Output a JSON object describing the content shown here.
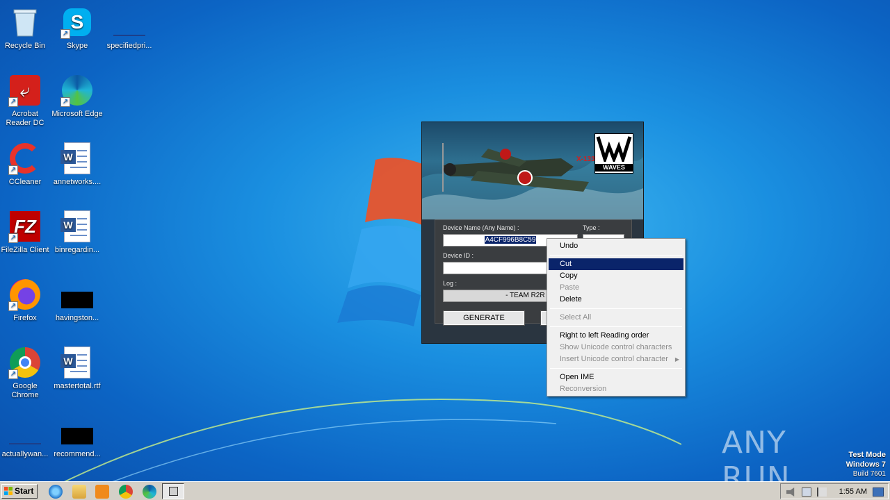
{
  "desktop": {
    "icons": [
      {
        "label": "Recycle Bin"
      },
      {
        "label": "Skype"
      },
      {
        "label": "specifiedpri..."
      },
      {
        "label": "Acrobat Reader DC"
      },
      {
        "label": "Microsoft Edge"
      },
      {
        "label": "CCleaner"
      },
      {
        "label": "annetworks...."
      },
      {
        "label": "FileZilla Client"
      },
      {
        "label": "binregardin..."
      },
      {
        "label": "Firefox"
      },
      {
        "label": "havingston..."
      },
      {
        "label": "Google Chrome"
      },
      {
        "label": "mastertotal.rtf"
      },
      {
        "label": "actuallywan..."
      },
      {
        "label": "recommend..."
      }
    ]
  },
  "keygen": {
    "brand": "WAVES",
    "plane_marking": "X-133",
    "device_name_label": "Device Name (Any Name) :",
    "type_label": "Type :",
    "device_name_value": "A4CF996B8C59",
    "device_id_label": "Device ID :",
    "log_label": "Log :",
    "log_value": "- TEAM R2R PRE",
    "generate_button": "GENERATE"
  },
  "context_menu": {
    "items": [
      {
        "label": "Undo",
        "enabled": true
      },
      {
        "label": "Cut",
        "enabled": true,
        "highlighted": true
      },
      {
        "label": "Copy",
        "enabled": true
      },
      {
        "label": "Paste",
        "enabled": false
      },
      {
        "label": "Delete",
        "enabled": true
      },
      {
        "label": "Select All",
        "enabled": false
      },
      {
        "label": "Right to left Reading order",
        "enabled": true
      },
      {
        "label": "Show Unicode control characters",
        "enabled": false
      },
      {
        "label": "Insert Unicode control character",
        "enabled": false
      },
      {
        "label": "Open IME",
        "enabled": true
      },
      {
        "label": "Reconversion",
        "enabled": false
      }
    ]
  },
  "taskbar": {
    "start_label": "Start",
    "clock": "1:55 AM"
  },
  "watermark": {
    "logo": "ANY RUN",
    "mode_line1": "Test Mode",
    "mode_line2": "Windows 7",
    "mode_line3": "Build 7601"
  },
  "colors": {
    "selection": "#0a246a",
    "desktop_blue": "#1a8fe0",
    "menu_bg": "#f0f0f0"
  }
}
